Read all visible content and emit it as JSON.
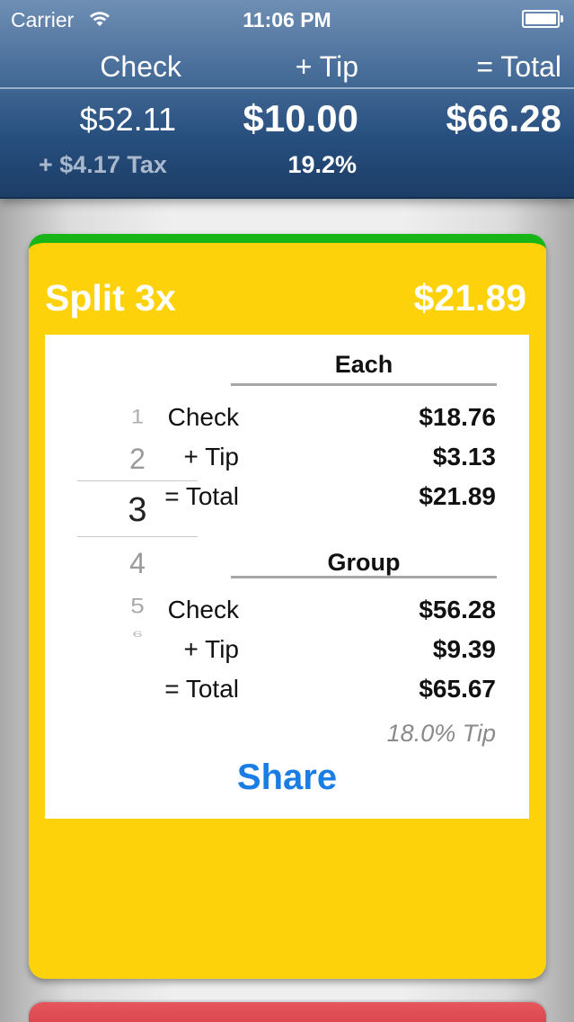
{
  "status_bar": {
    "carrier": "Carrier",
    "time": "11:06 PM"
  },
  "summary": {
    "check_label": "Check",
    "tip_label": "+ Tip",
    "total_label": "= Total",
    "check_value": "$52.11",
    "tip_value": "$10.00",
    "total_value": "$66.28",
    "tax_text": "+ $4.17 Tax",
    "tip_percent": "19.2%"
  },
  "split_card": {
    "title": "Split  3x",
    "amount": "$21.89",
    "accent_color": "#18b418",
    "card_color": "#fdd20a",
    "picker": {
      "items": [
        "1",
        "2",
        "3",
        "4",
        "5",
        "6"
      ],
      "selected": "3"
    },
    "each": {
      "title": "Each",
      "rows": [
        {
          "label": "Check",
          "value": "$18.76"
        },
        {
          "label": "+ Tip",
          "value": "$3.13"
        },
        {
          "label": "= Total",
          "value": "$21.89"
        }
      ]
    },
    "group": {
      "title": "Group",
      "rows": [
        {
          "label": "Check",
          "value": "$56.28"
        },
        {
          "label": "+ Tip",
          "value": "$9.39"
        },
        {
          "label": "= Total",
          "value": "$65.67"
        }
      ]
    },
    "tip_note": "18.0% Tip",
    "share_label": "Share"
  },
  "next_card_color": "#dd4a50"
}
